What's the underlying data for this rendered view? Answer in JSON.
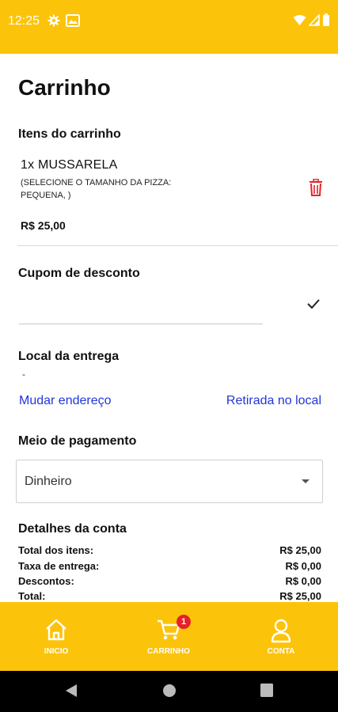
{
  "status_bar": {
    "time": "12:25"
  },
  "page": {
    "title": "Carrinho"
  },
  "cart": {
    "heading": "Itens do carrinho",
    "items": [
      {
        "name": "1x MUSSARELA",
        "note": "(SELECIONE O TAMANHO DA PIZZA: PEQUENA, )",
        "price": "R$ 25,00"
      }
    ]
  },
  "coupon": {
    "heading": "Cupom de desconto",
    "value": ""
  },
  "delivery": {
    "heading": "Local da entrega",
    "address": "-",
    "change_address_link": "Mudar endereço",
    "pickup_link": "Retirada no local"
  },
  "payment": {
    "heading": "Meio de pagamento",
    "selected": "Dinheiro"
  },
  "summary": {
    "heading": "Detalhes da conta",
    "rows": [
      {
        "label": "Total dos itens:",
        "value": "R$ 25,00"
      },
      {
        "label": "Taxa de entrega:",
        "value": "R$ 0,00"
      },
      {
        "label": "Descontos:",
        "value": "R$ 0,00"
      },
      {
        "label": "Total:",
        "value": "R$ 25,00"
      }
    ]
  },
  "bottom_nav": {
    "items": [
      {
        "label": "INICIO",
        "icon": "home-icon"
      },
      {
        "label": "CARRINHO",
        "icon": "cart-icon",
        "badge": "1"
      },
      {
        "label": "CONTA",
        "icon": "user-icon"
      }
    ]
  },
  "colors": {
    "brand": "#FCC30B",
    "link": "#2136d6",
    "delete": "#E6212A",
    "badge": "#E6212A"
  }
}
